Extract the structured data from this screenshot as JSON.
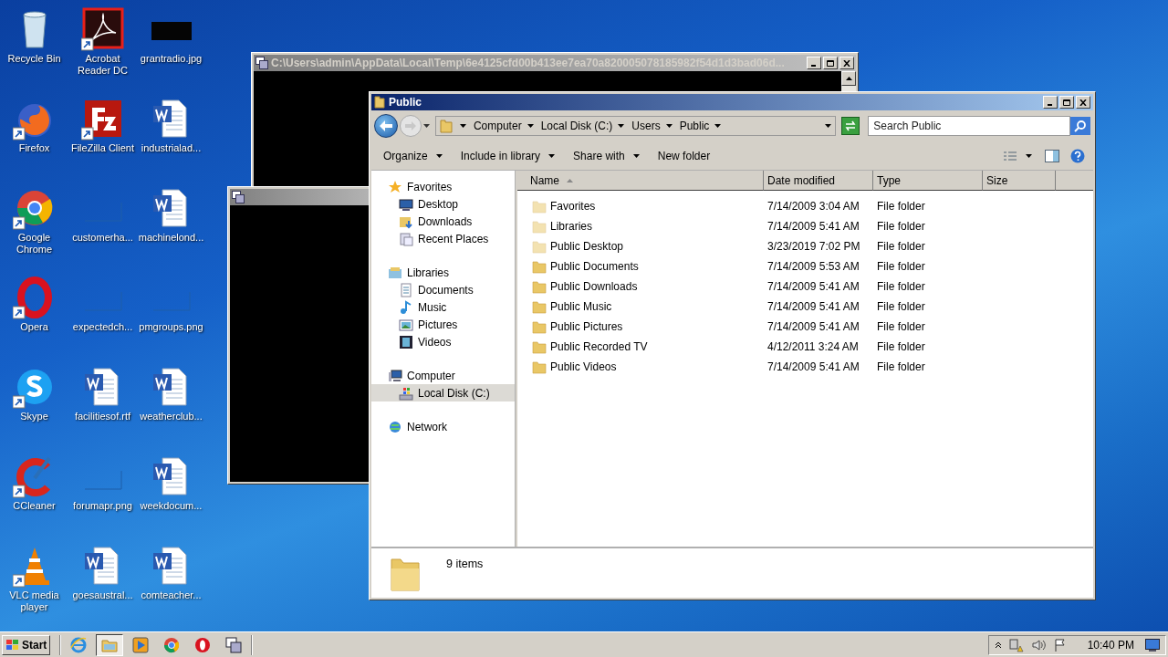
{
  "desktop_icons": [
    {
      "label": "Recycle Bin",
      "kind": "recycle-bin",
      "shortcut": false
    },
    {
      "label": "Firefox",
      "kind": "firefox",
      "shortcut": true
    },
    {
      "label": "Google Chrome",
      "kind": "chrome",
      "shortcut": true
    },
    {
      "label": "Opera",
      "kind": "opera",
      "shortcut": true
    },
    {
      "label": "Skype",
      "kind": "skype",
      "shortcut": true
    },
    {
      "label": "CCleaner",
      "kind": "ccleaner",
      "shortcut": true
    },
    {
      "label": "VLC media player",
      "kind": "vlc",
      "shortcut": true
    },
    {
      "label": "Acrobat Reader DC",
      "kind": "acrobat",
      "shortcut": true
    },
    {
      "label": "FileZilla Client",
      "kind": "filezilla",
      "shortcut": true
    },
    {
      "label": "customerha...",
      "kind": "blank-image",
      "shortcut": false
    },
    {
      "label": "expectedch...",
      "kind": "blank-image",
      "shortcut": false
    },
    {
      "label": "facilitiesof.rtf",
      "kind": "word",
      "shortcut": false
    },
    {
      "label": "forumapr.png",
      "kind": "blank-image",
      "shortcut": false
    },
    {
      "label": "goesaustral...",
      "kind": "word",
      "shortcut": false
    },
    {
      "label": "grantradio.jpg",
      "kind": "dark-image",
      "shortcut": false
    },
    {
      "label": "industrialad...",
      "kind": "word",
      "shortcut": false
    },
    {
      "label": "machinelond...",
      "kind": "word",
      "shortcut": false
    },
    {
      "label": "pmgroups.png",
      "kind": "blank-image",
      "shortcut": false
    },
    {
      "label": "weatherclub...",
      "kind": "word",
      "shortcut": false
    },
    {
      "label": "weekdocum...",
      "kind": "word",
      "shortcut": false
    },
    {
      "label": "comteacher...",
      "kind": "word",
      "shortcut": false
    }
  ],
  "console_window": {
    "title": "C:\\Users\\admin\\AppData\\Local\\Temp\\6e4125cfd00b413ee7ea70a820005078185982f54d1d3bad06d..."
  },
  "explorer": {
    "title": "Public",
    "path": [
      "Computer",
      "Local Disk (C:)",
      "Users",
      "Public"
    ],
    "search": {
      "placeholder": "Search Public"
    },
    "toolbar": [
      {
        "label": "Organize",
        "dropdown": true
      },
      {
        "label": "Include in library",
        "dropdown": true
      },
      {
        "label": "Share with",
        "dropdown": true
      },
      {
        "label": "New folder",
        "dropdown": false
      }
    ],
    "nav": [
      {
        "label": "Favorites",
        "kind": "star",
        "selected": false,
        "children": [
          {
            "label": "Desktop",
            "kind": "desktop",
            "selected": false
          },
          {
            "label": "Downloads",
            "kind": "downloads",
            "selected": false
          },
          {
            "label": "Recent Places",
            "kind": "recent",
            "selected": false
          }
        ]
      },
      {
        "label": "Libraries",
        "kind": "library",
        "selected": false,
        "children": [
          {
            "label": "Documents",
            "kind": "documents",
            "selected": false
          },
          {
            "label": "Music",
            "kind": "music",
            "selected": false
          },
          {
            "label": "Pictures",
            "kind": "pictures",
            "selected": false
          },
          {
            "label": "Videos",
            "kind": "videos",
            "selected": false
          }
        ]
      },
      {
        "label": "Computer",
        "kind": "computer",
        "selected": false,
        "children": [
          {
            "label": "Local Disk (C:)",
            "kind": "disk",
            "selected": true
          }
        ]
      },
      {
        "label": "Network",
        "kind": "network",
        "selected": false
      }
    ],
    "columns": [
      {
        "label": "Name",
        "sorted": true
      },
      {
        "label": "Date modified",
        "sorted": false
      },
      {
        "label": "Type",
        "sorted": false
      },
      {
        "label": "Size",
        "sorted": false
      }
    ],
    "rows": [
      {
        "name": "Favorites",
        "date": "7/14/2009 3:04 AM",
        "type": "File folder",
        "hidden": true
      },
      {
        "name": "Libraries",
        "date": "7/14/2009 5:41 AM",
        "type": "File folder",
        "hidden": true
      },
      {
        "name": "Public Desktop",
        "date": "3/23/2019 7:02 PM",
        "type": "File folder",
        "hidden": true
      },
      {
        "name": "Public Documents",
        "date": "7/14/2009 5:53 AM",
        "type": "File folder",
        "hidden": false
      },
      {
        "name": "Public Downloads",
        "date": "7/14/2009 5:41 AM",
        "type": "File folder",
        "hidden": false
      },
      {
        "name": "Public Music",
        "date": "7/14/2009 5:41 AM",
        "type": "File folder",
        "hidden": false
      },
      {
        "name": "Public Pictures",
        "date": "7/14/2009 5:41 AM",
        "type": "File folder",
        "hidden": false
      },
      {
        "name": "Public Recorded TV",
        "date": "4/12/2011 3:24 AM",
        "type": "File folder",
        "hidden": false
      },
      {
        "name": "Public Videos",
        "date": "7/14/2009 5:41 AM",
        "type": "File folder",
        "hidden": false
      }
    ],
    "status": "9 items"
  },
  "taskbar": {
    "start": "Start",
    "buttons": [
      {
        "kind": "ie",
        "selected": false
      },
      {
        "kind": "explorer",
        "selected": true
      },
      {
        "kind": "media",
        "selected": false
      },
      {
        "kind": "chrome",
        "selected": false
      },
      {
        "kind": "opera",
        "selected": false
      },
      {
        "kind": "console",
        "selected": false
      }
    ],
    "clock": "10:40 PM"
  }
}
